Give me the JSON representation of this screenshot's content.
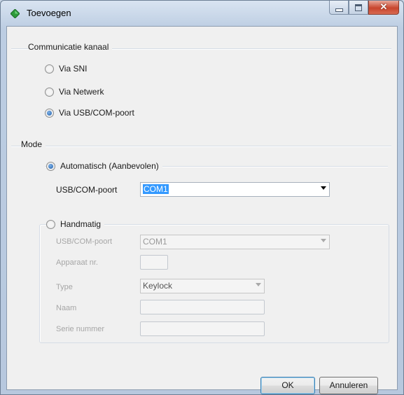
{
  "window": {
    "title": "Toevoegen"
  },
  "channel_group": {
    "title": "Communicatie kanaal",
    "options": [
      {
        "label": "Via SNI",
        "checked": false
      },
      {
        "label": "Via Netwerk",
        "checked": false
      },
      {
        "label": "Via USB/COM-poort",
        "checked": true
      }
    ]
  },
  "mode_group": {
    "title": "Mode",
    "automatic": {
      "label": "Automatisch (Aanbevolen)",
      "checked": true,
      "port_label": "USB/COM-poort",
      "port_value": "COM1"
    },
    "manual": {
      "label": "Handmatig",
      "checked": false,
      "port_label": "USB/COM-poort",
      "port_value": "COM1",
      "device_nr_label": "Apparaat nr.",
      "device_nr_value": "",
      "type_label": "Type",
      "type_value": "Keylock",
      "name_label": "Naam",
      "name_value": "",
      "serial_label": "Serie nummer",
      "serial_value": ""
    }
  },
  "buttons": {
    "ok": "OK",
    "cancel": "Annuleren"
  },
  "colors": {
    "accent": "#3399ff",
    "close": "#c8452d",
    "title_icon": "#2e9b3a"
  }
}
